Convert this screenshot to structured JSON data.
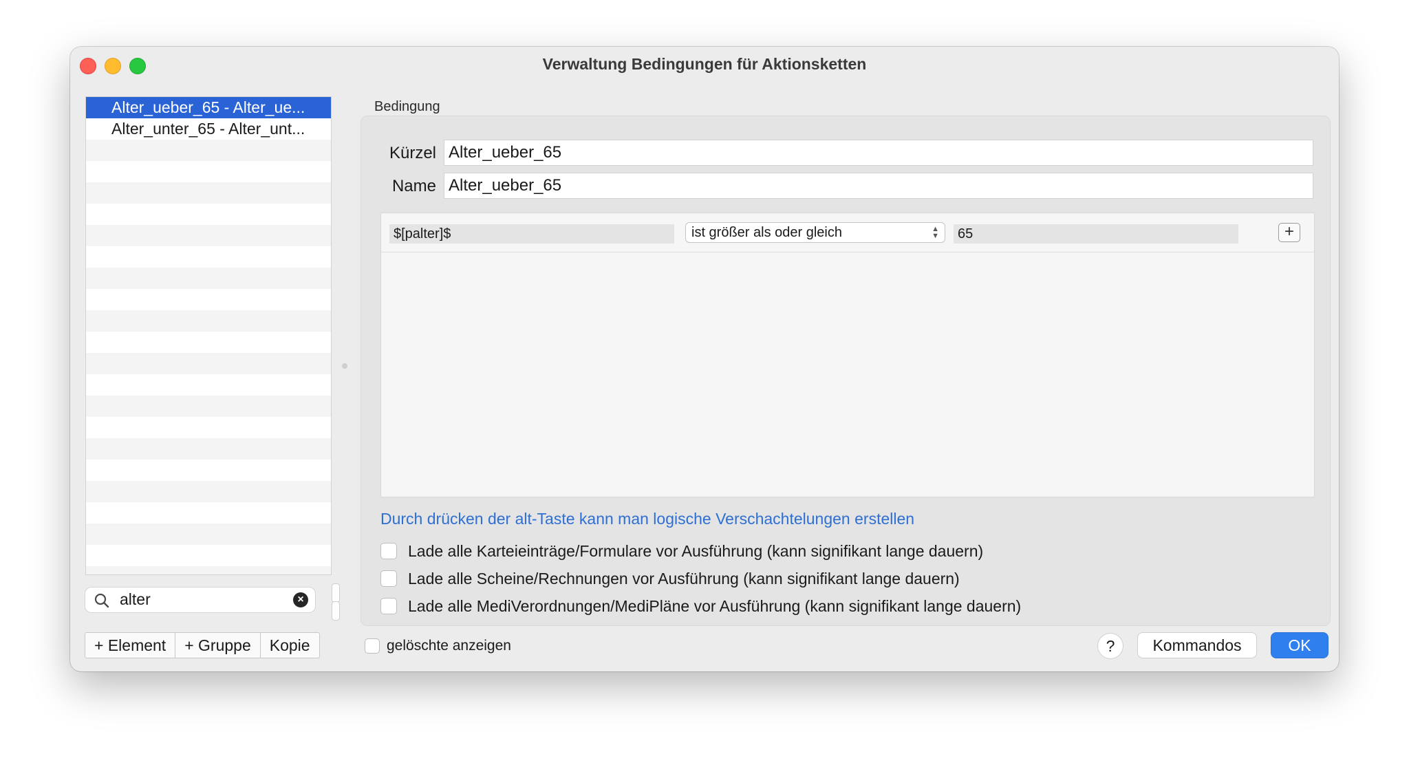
{
  "window": {
    "title": "Verwaltung Bedingungen für Aktionsketten"
  },
  "sidebar": {
    "items": [
      {
        "label": "Alter_ueber_65 - Alter_ue...",
        "selected": true
      },
      {
        "label": "Alter_unter_65 - Alter_unt...",
        "selected": false
      }
    ],
    "search": {
      "value": "alter",
      "placeholder": ""
    },
    "buttons": {
      "add_element": "+ Element",
      "add_group": "+ Gruppe",
      "copy": "Kopie"
    }
  },
  "condition": {
    "group_label": "Bedingung",
    "kuerzel_label": "Kürzel",
    "kuerzel_value": "Alter_ueber_65",
    "name_label": "Name",
    "name_value": "Alter_ueber_65",
    "rule": {
      "variable": "$[palter]$",
      "operator": "ist größer als oder gleich",
      "value": "65",
      "add_label": "+"
    },
    "hint": "Durch drücken der alt-Taste kann man logische Verschachtelungen erstellen",
    "options": [
      {
        "label": "Lade alle Karteieinträge/Formulare vor Ausführung (kann signifikant lange dauern)",
        "checked": false
      },
      {
        "label": "Lade alle Scheine/Rechnungen vor Ausführung (kann signifikant lange dauern)",
        "checked": false
      },
      {
        "label": "Lade alle MediVerordnungen/MediPläne vor Ausführung (kann signifikant lange dauern)",
        "checked": false
      }
    ]
  },
  "footer": {
    "show_deleted": "gelöschte anzeigen",
    "help": "?",
    "commands": "Kommandos",
    "ok": "OK"
  },
  "colors": {
    "selection": "#2a63d6",
    "accent": "#2f80ee",
    "hint": "#2e6fd3"
  }
}
